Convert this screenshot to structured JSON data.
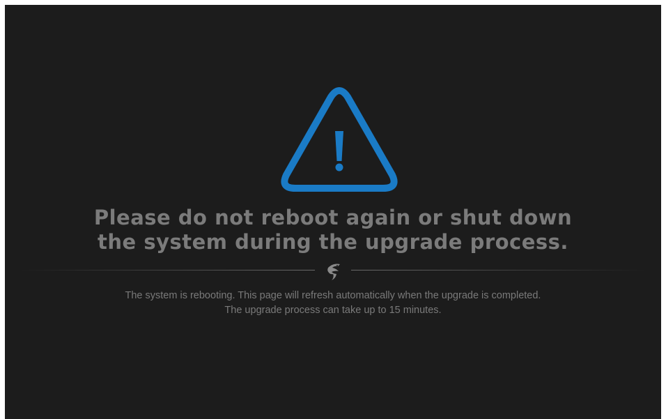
{
  "notice": {
    "icon": "warning-triangle-icon",
    "accent_color": "#1a7bc6",
    "headline_lines": [
      "Please do not reboot again or shut down",
      "the system during the upgrade process."
    ],
    "divider_icon": "shark-logo-icon",
    "description_lines": [
      "The system is rebooting. This page will refresh automatically when the upgrade is completed.",
      "The upgrade process can take up to 15 minutes."
    ]
  }
}
